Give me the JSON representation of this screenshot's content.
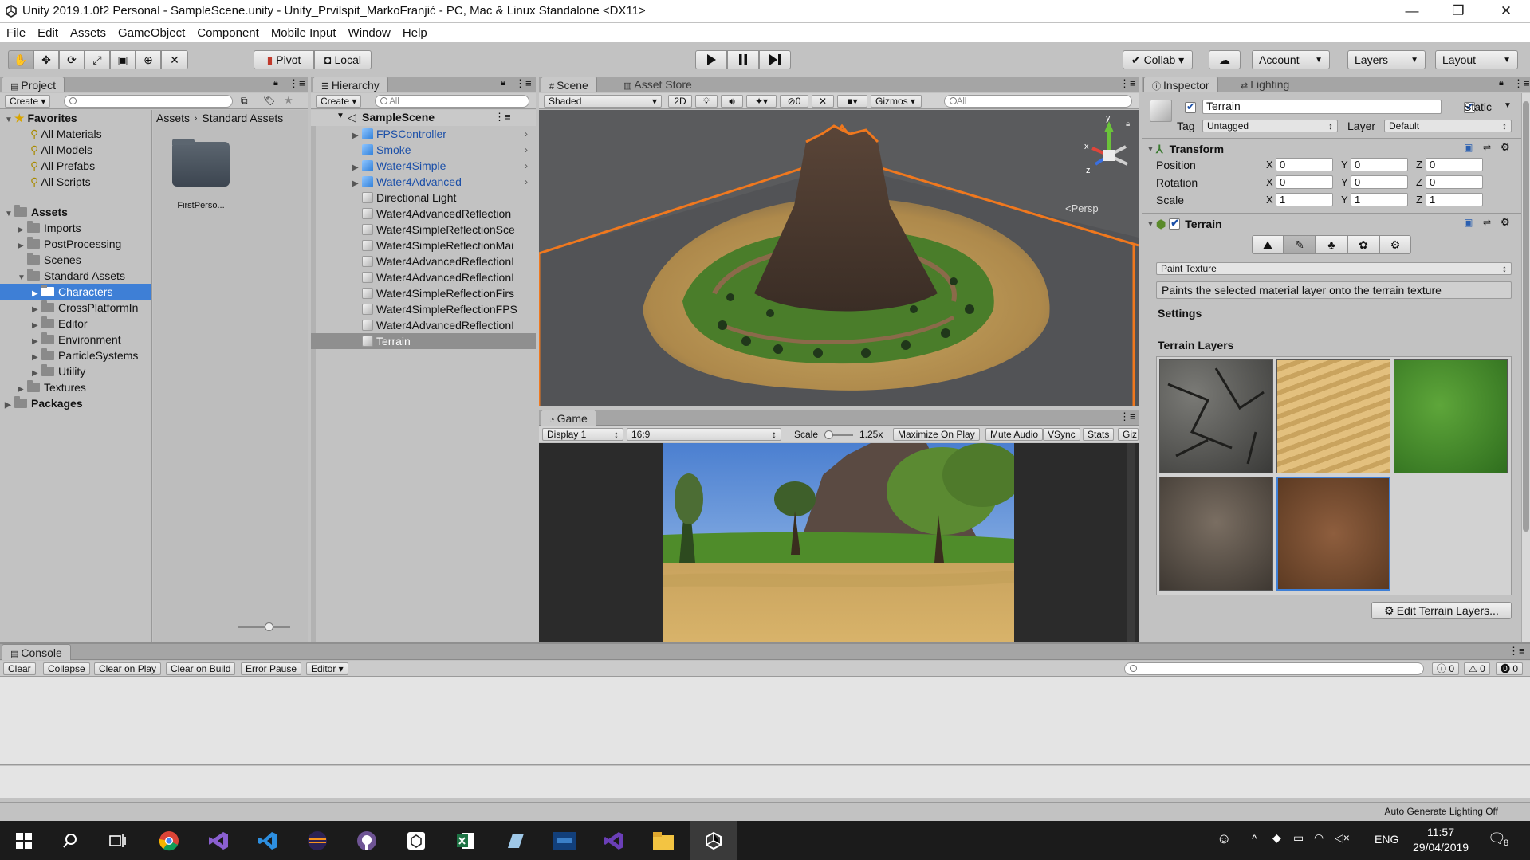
{
  "window": {
    "title": "Unity 2019.1.0f2 Personal - SampleScene.unity - Unity_Prvilspit_MarkoFranjić - PC, Mac & Linux Standalone <DX11>",
    "controls": {
      "minimize": "—",
      "maximize": "❐",
      "close": "✕"
    }
  },
  "menu": [
    "File",
    "Edit",
    "Assets",
    "GameObject",
    "Component",
    "Mobile Input",
    "Window",
    "Help"
  ],
  "toolbar": {
    "pivot": "Pivot",
    "local": "Local",
    "collab": "Collab ▾",
    "account": "Account",
    "layers": "Layers",
    "layout": "Layout"
  },
  "project": {
    "tab": "Project",
    "create": "Create",
    "breadcrumb": [
      "Assets",
      "Standard Assets"
    ],
    "favorites_label": "Favorites",
    "favorites": [
      "All Materials",
      "All Models",
      "All Prefabs",
      "All Scripts"
    ],
    "assets_label": "Assets",
    "assets_children": [
      "Imports",
      "PostProcessing",
      "Scenes",
      "Standard Assets"
    ],
    "standard_children": [
      "Characters",
      "CrossPlatformIn",
      "Editor",
      "Environment",
      "ParticleSystems",
      "Utility"
    ],
    "textures": "Textures",
    "packages": "Packages",
    "grid_item": "FirstPerso..."
  },
  "hierarchy": {
    "tab": "Hierarchy",
    "create": "Create",
    "search_placeholder": "All",
    "scene": "SampleScene",
    "items": [
      "FPSController",
      "Smoke",
      "Water4Simple",
      "Water4Advanced",
      "Directional Light",
      "Water4AdvancedReflection",
      "Water4SimpleReflectionSce",
      "Water4SimpleReflectionMai",
      "Water4AdvancedReflectionI",
      "Water4AdvancedReflectionI",
      "Water4SimpleReflectionFirs",
      "Water4SimpleReflectionFPS",
      "Water4AdvancedReflectionI",
      "Terrain"
    ]
  },
  "scene": {
    "tab": "Scene",
    "tab2": "Asset Store",
    "shading": "Shaded",
    "two_d": "2D",
    "hidden_count": "0",
    "gizmos": "Gizmos",
    "search_placeholder": "All",
    "persp": "Persp",
    "axes": {
      "x": "x",
      "y": "y",
      "z": "z"
    }
  },
  "game": {
    "tab": "Game",
    "display": "Display 1",
    "aspect": "16:9",
    "scale_label": "Scale",
    "scale_value": "1.25x",
    "maximize": "Maximize On Play",
    "mute": "Mute Audio",
    "vsync": "VSync",
    "stats": "Stats",
    "gizmos": "Giz"
  },
  "inspector": {
    "tab": "Inspector",
    "tab2": "Lighting",
    "object_name": "Terrain",
    "static_label": "Static",
    "tag_label": "Tag",
    "tag_value": "Untagged",
    "layer_label": "Layer",
    "layer_value": "Default",
    "transform": {
      "title": "Transform",
      "rows": [
        {
          "label": "Position",
          "x": "0",
          "y": "0",
          "z": "0"
        },
        {
          "label": "Rotation",
          "x": "0",
          "y": "0",
          "z": "0"
        },
        {
          "label": "Scale",
          "x": "1",
          "y": "1",
          "z": "1"
        }
      ]
    },
    "terrain": {
      "title": "Terrain",
      "mode": "Paint Texture",
      "description": "Paints the selected material layer onto the terrain texture",
      "settings": "Settings",
      "layers_title": "Terrain Layers",
      "edit_layers": "Edit Terrain Layers..."
    }
  },
  "console": {
    "tab": "Console",
    "buttons": [
      "Clear",
      "Collapse",
      "Clear on Play",
      "Clear on Build",
      "Error Pause",
      "Editor ▾"
    ],
    "counts": {
      "info": "0",
      "warn": "0",
      "error": "0"
    }
  },
  "status": {
    "text": "Auto Generate Lighting Off"
  },
  "taskbar": {
    "lang": "ENG",
    "time": "11:57",
    "date": "29/04/2019",
    "notif": "8"
  },
  "colors": {
    "selection": "#3e7fd6",
    "orange_outline": "#f0781e",
    "accent_blue": "#1b4fa8"
  }
}
